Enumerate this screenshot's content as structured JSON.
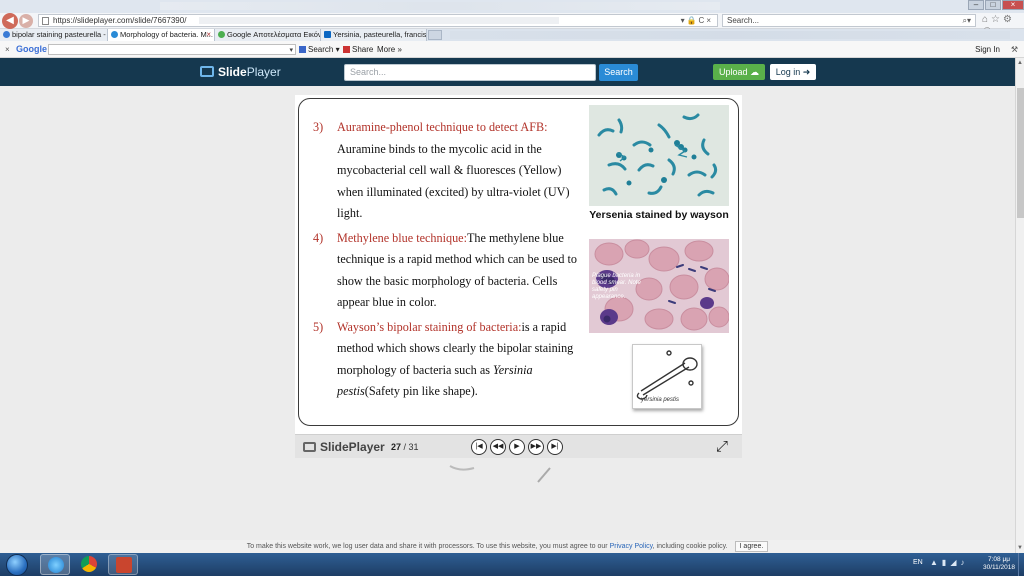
{
  "browser": {
    "address_url": "https://slideplayer.com/slide/7667390/",
    "search_placeholder": "Search...",
    "tabs": [
      {
        "label": "bipolar staining pasteurella - A...",
        "active": false,
        "color": "#3a7bd5"
      },
      {
        "label": "Morphology of bacteria. M...",
        "active": true,
        "color": "#2a8bd6"
      },
      {
        "label": "Google Αποτελέσματα Εικόνω...",
        "active": false,
        "color": "#4caf50"
      },
      {
        "label": "Yersinia, pasteurella, francisella",
        "active": false,
        "color": "#0a66c2"
      }
    ],
    "google_toolbar": {
      "logo": "Google",
      "search_label": "Search",
      "share_label": "Share",
      "more_label": "More »",
      "signin_label": "Sign In"
    }
  },
  "site": {
    "logo_part1": "Slide",
    "logo_part2": "Player",
    "search_placeholder": "Search...",
    "search_button": "Search",
    "upload_button": "Upload",
    "login_button": "Log in"
  },
  "slide": {
    "items": [
      {
        "num": "3)",
        "heading": "Auramine-phenol technique to detect AFB:",
        "body": " Auramine binds to the mycolic acid in the mycobacterial cell wall & fluoresces (Yellow) when illuminated (excited) by ultra-violet (UV) light."
      },
      {
        "num": "4)",
        "heading": "Methylene blue technique:",
        "body": "The methylene blue technique is a rapid method which can be used to show the basic morphology of bacteria. Cells appear blue in color."
      },
      {
        "num": "5)",
        "heading": "Wayson’s bipolar staining of bacteria:",
        "body": "is a rapid method which shows clearly the bipolar staining morphology of bacteria such as ",
        "italic": "Yersinia pestis",
        "tail": "(Safety pin like shape)."
      }
    ],
    "image1_caption": "Yersenia stained by wayson",
    "image2_overlay": "Plague bacteria in blood smear. Note safety pin appearance.",
    "image3_overlay": "yersinia pestis"
  },
  "player": {
    "logo": "SlidePlayer",
    "current_page": "27",
    "total_pages": "/ 31"
  },
  "cookie": {
    "text_before": "To make this website work, we log user data and share it with processors. To use this website, you must agree to our ",
    "policy_link": "Privacy Policy",
    "text_after": ", including cookie policy.",
    "agree_button": "I agree."
  },
  "taskbar": {
    "language": "EN",
    "time": "7:08 μμ",
    "date": "30/11/2018"
  },
  "colors": {
    "header_bg": "#15384f",
    "slide_accent": "#b2332a",
    "search_button": "#2a8bd6",
    "upload_button": "#5ab04a"
  }
}
